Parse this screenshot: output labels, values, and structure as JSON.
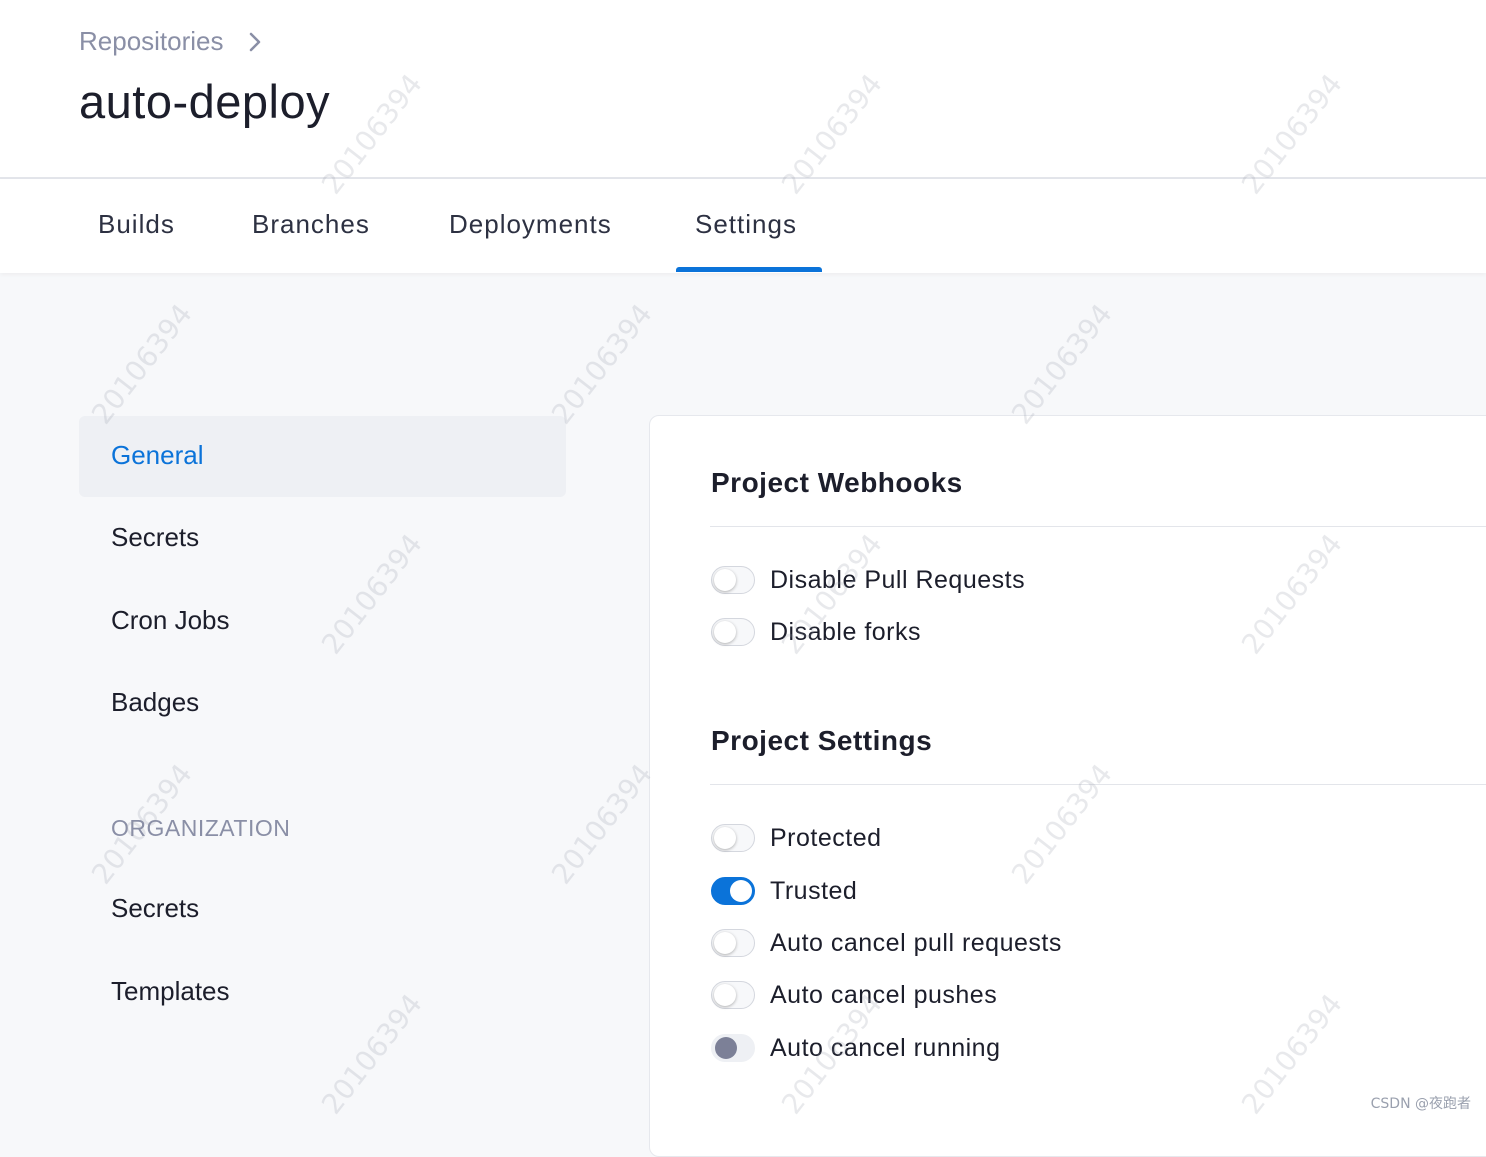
{
  "breadcrumb": {
    "label": "Repositories"
  },
  "page": {
    "title": "auto-deploy"
  },
  "tabs": [
    {
      "label": "Builds"
    },
    {
      "label": "Branches"
    },
    {
      "label": "Deployments"
    },
    {
      "label": "Settings",
      "active": true
    }
  ],
  "sidebar": {
    "items": [
      {
        "label": "General",
        "active": true
      },
      {
        "label": "Secrets"
      },
      {
        "label": "Cron Jobs"
      },
      {
        "label": "Badges"
      }
    ],
    "org_section": {
      "label": "ORGANIZATION",
      "items": [
        {
          "label": "Secrets"
        },
        {
          "label": "Templates"
        }
      ]
    }
  },
  "webhooks": {
    "title": "Project Webhooks",
    "toggles": [
      {
        "label": "Disable Pull Requests",
        "state": "off"
      },
      {
        "label": "Disable forks",
        "state": "off"
      }
    ]
  },
  "settings": {
    "title": "Project Settings",
    "toggles": [
      {
        "label": "Protected",
        "state": "off"
      },
      {
        "label": "Trusted",
        "state": "on"
      },
      {
        "label": "Auto cancel pull requests",
        "state": "off"
      },
      {
        "label": "Auto cancel pushes",
        "state": "off"
      },
      {
        "label": "Auto cancel running",
        "state": "disabled"
      }
    ]
  },
  "watermark": {
    "text": "20106394"
  },
  "credit": {
    "text": "CSDN @夜跑者"
  },
  "colors": {
    "accent": "#0b73d9",
    "muted": "#8a8fa6"
  }
}
